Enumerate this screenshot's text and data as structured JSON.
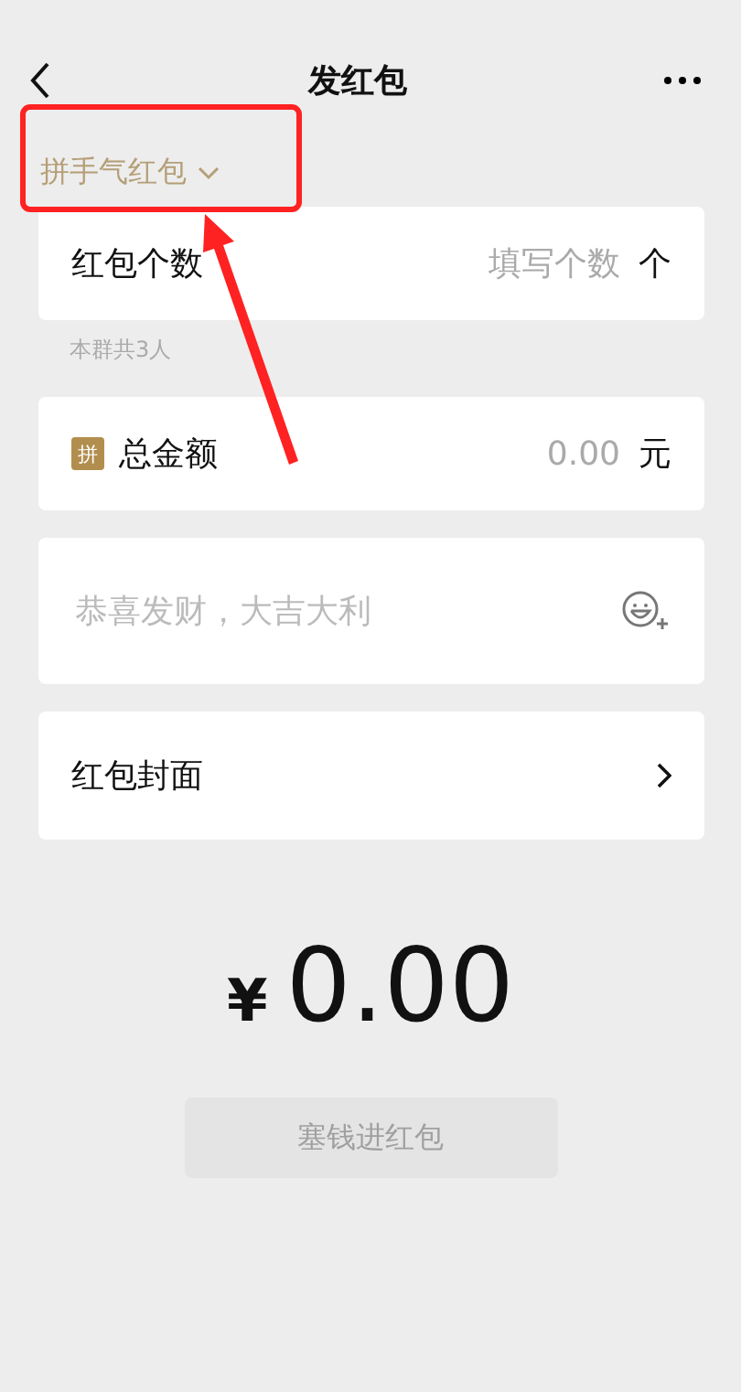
{
  "nav": {
    "title": "发红包"
  },
  "mode_selector": {
    "label": "拼手气红包"
  },
  "count_row": {
    "label": "红包个数",
    "placeholder": "填写个数",
    "unit": "个"
  },
  "group_hint": "本群共3人",
  "amount_row": {
    "badge": "拼",
    "label": "总金额",
    "placeholder": "0.00",
    "unit": "元"
  },
  "greeting": {
    "placeholder": "恭喜发财，大吉大利"
  },
  "cover_row": {
    "label": "红包封面"
  },
  "total": {
    "currency": "¥",
    "value": "0.00"
  },
  "submit_button": {
    "label": "塞钱进红包",
    "disabled": true
  }
}
